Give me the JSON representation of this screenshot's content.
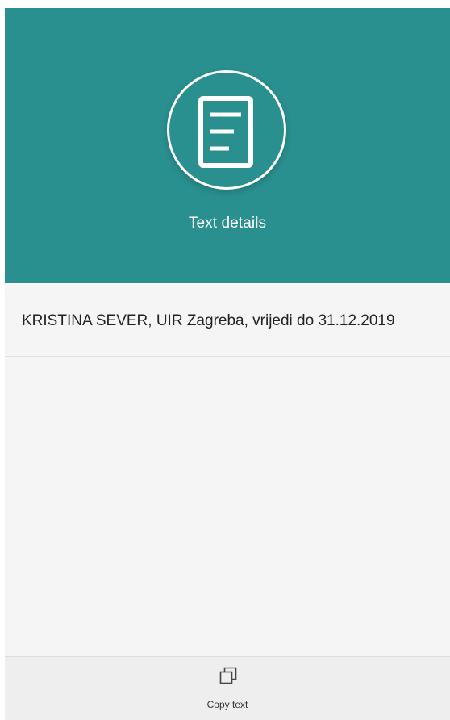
{
  "header": {
    "icon": "document-icon",
    "title": "Text details",
    "background_color": "#2a8f8f"
  },
  "content": {
    "text_value": "KRISTINA SEVER, UIR Zagreba, vrijedi do 31.12.2019"
  },
  "bottom_bar": {
    "copy_icon": "copy-icon",
    "copy_label": "Copy text"
  }
}
